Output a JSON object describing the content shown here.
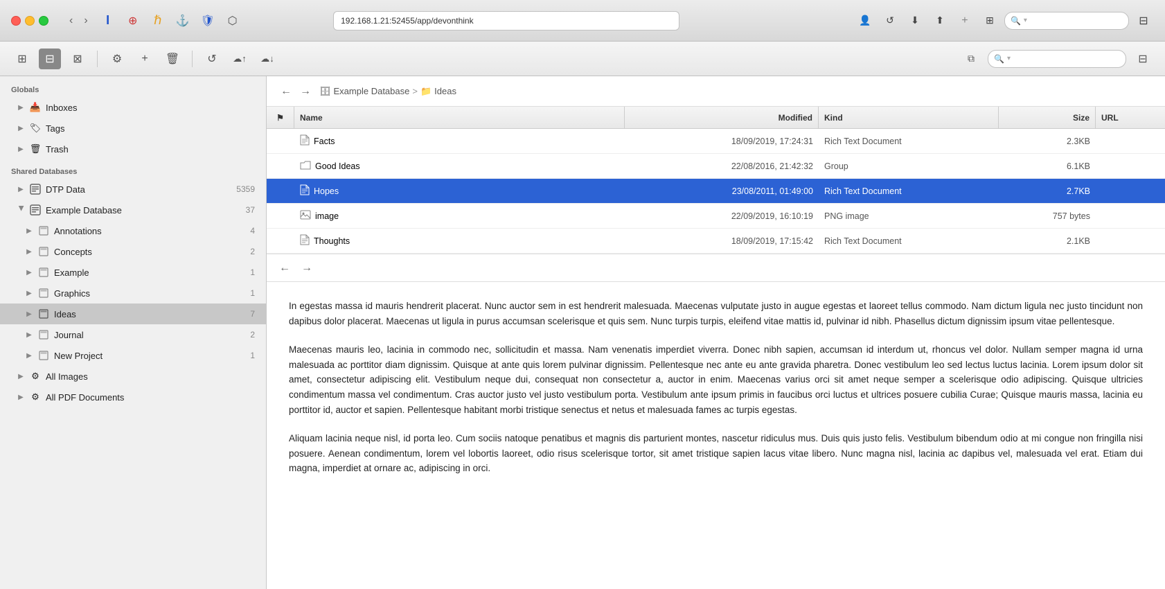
{
  "titlebar": {
    "address": "192.168.1.21:52455/app/devonthink",
    "search_placeholder": "Search"
  },
  "toolbar2": {
    "icons": [
      "⚙",
      "+",
      "🗑",
      "↺",
      "☁↑",
      "☁↓"
    ]
  },
  "sidebar": {
    "globals_label": "Globals",
    "items": [
      {
        "id": "inboxes",
        "label": "Inboxes",
        "icon": "📥",
        "indent": 1,
        "expandable": true
      },
      {
        "id": "tags",
        "label": "Tags",
        "icon": "🏷",
        "indent": 1,
        "expandable": true
      },
      {
        "id": "trash",
        "label": "Trash",
        "icon": "🗑",
        "indent": 1,
        "expandable": true
      }
    ],
    "shared_db_label": "Shared Databases",
    "databases": [
      {
        "id": "dtp-data",
        "label": "DTP Data",
        "icon": "db",
        "count": "5359",
        "indent": 1,
        "expandable": true
      },
      {
        "id": "example-database",
        "label": "Example Database",
        "icon": "db",
        "count": "37",
        "indent": 1,
        "expandable": true,
        "expanded": true
      },
      {
        "id": "annotations",
        "label": "Annotations",
        "icon": "folder",
        "count": "4",
        "indent": 2,
        "expandable": true
      },
      {
        "id": "concepts",
        "label": "Concepts",
        "icon": "folder",
        "count": "2",
        "indent": 2,
        "expandable": true
      },
      {
        "id": "example",
        "label": "Example",
        "icon": "folder",
        "count": "1",
        "indent": 2,
        "expandable": true
      },
      {
        "id": "graphics",
        "label": "Graphics",
        "icon": "folder",
        "count": "1",
        "indent": 2,
        "expandable": true
      },
      {
        "id": "ideas",
        "label": "Ideas",
        "icon": "folder",
        "count": "7",
        "indent": 2,
        "expandable": true,
        "selected": true
      },
      {
        "id": "journal",
        "label": "Journal",
        "icon": "folder",
        "count": "2",
        "indent": 2,
        "expandable": true
      },
      {
        "id": "new-project",
        "label": "New Project",
        "icon": "folder",
        "count": "1",
        "indent": 2,
        "expandable": true
      },
      {
        "id": "all-images",
        "label": "All Images",
        "icon": "gear",
        "indent": 1,
        "expandable": true
      },
      {
        "id": "all-pdf",
        "label": "All PDF Documents",
        "icon": "gear",
        "indent": 1,
        "expandable": true
      }
    ]
  },
  "breadcrumb": {
    "db_name": "Example Database",
    "folder_name": "Ideas",
    "separator": ">"
  },
  "file_list": {
    "columns": [
      "",
      "Name",
      "Modified",
      "Kind",
      "Size",
      "URL"
    ],
    "rows": [
      {
        "flag": "",
        "name": "Facts",
        "icon": "doc",
        "modified": "18/09/2019, 17:24:31",
        "kind": "Rich Text Document",
        "size": "2.3KB",
        "url": ""
      },
      {
        "flag": "",
        "name": "Good Ideas",
        "icon": "folder",
        "modified": "22/08/2016, 21:42:32",
        "kind": "Group",
        "size": "6.1KB",
        "url": ""
      },
      {
        "flag": "",
        "name": "Hopes",
        "icon": "doc",
        "modified": "23/08/2011, 01:49:00",
        "kind": "Rich Text Document",
        "size": "2.7KB",
        "url": "",
        "selected": true
      },
      {
        "flag": "",
        "name": "image",
        "icon": "img",
        "modified": "22/09/2019, 16:10:19",
        "kind": "PNG image",
        "size": "757 bytes",
        "url": ""
      },
      {
        "flag": "",
        "name": "Thoughts",
        "icon": "doc",
        "modified": "18/09/2019, 17:15:42",
        "kind": "Rich Text Document",
        "size": "2.1KB",
        "url": ""
      }
    ]
  },
  "content": {
    "paragraphs": [
      "In egestas massa id mauris hendrerit placerat. Nunc auctor sem in est hendrerit malesuada. Maecenas vulputate justo in augue egestas et laoreet tellus commodo. Nam dictum ligula nec justo tincidunt non dapibus dolor placerat. Maecenas ut ligula in purus accumsan scelerisque et quis sem. Nunc turpis turpis, eleifend vitae mattis id, pulvinar id nibh. Phasellus dictum dignissim ipsum vitae pellentesque.",
      "Maecenas mauris leo, lacinia in commodo nec, sollicitudin et massa. Nam venenatis imperdiet viverra. Donec nibh sapien, accumsan id interdum ut, rhoncus vel dolor. Nullam semper magna id urna malesuada ac porttitor diam dignissim. Quisque at ante quis lorem pulvinar dignissim. Pellentesque nec ante eu ante gravida pharetra. Donec vestibulum leo sed lectus luctus lacinia. Lorem ipsum dolor sit amet, consectetur adipiscing elit. Vestibulum neque dui, consequat non consectetur a, auctor in enim. Maecenas varius orci sit amet neque semper a scelerisque odio adipiscing. Quisque ultricies condimentum massa vel condimentum. Cras auctor justo vel justo vestibulum porta. Vestibulum ante ipsum primis in faucibus orci luctus et ultrices posuere cubilia Curae; Quisque mauris massa, lacinia eu porttitor id, auctor et sapien. Pellentesque habitant morbi tristique senectus et netus et malesuada fames ac turpis egestas.",
      "Aliquam lacinia neque nisl, id porta leo. Cum sociis natoque penatibus et magnis dis parturient montes, nascetur ridiculus mus. Duis quis justo felis. Vestibulum bibendum odio at mi congue non fringilla nisi posuere. Aenean condimentum, lorem vel lobortis laoreet, odio risus scelerisque tortor, sit amet tristique sapien lacus vitae libero. Nunc magna nisl, lacinia ac dapibus vel, malesuada vel erat. Etiam dui magna, imperdiet at ornare ac, adipiscing in orci."
    ]
  }
}
